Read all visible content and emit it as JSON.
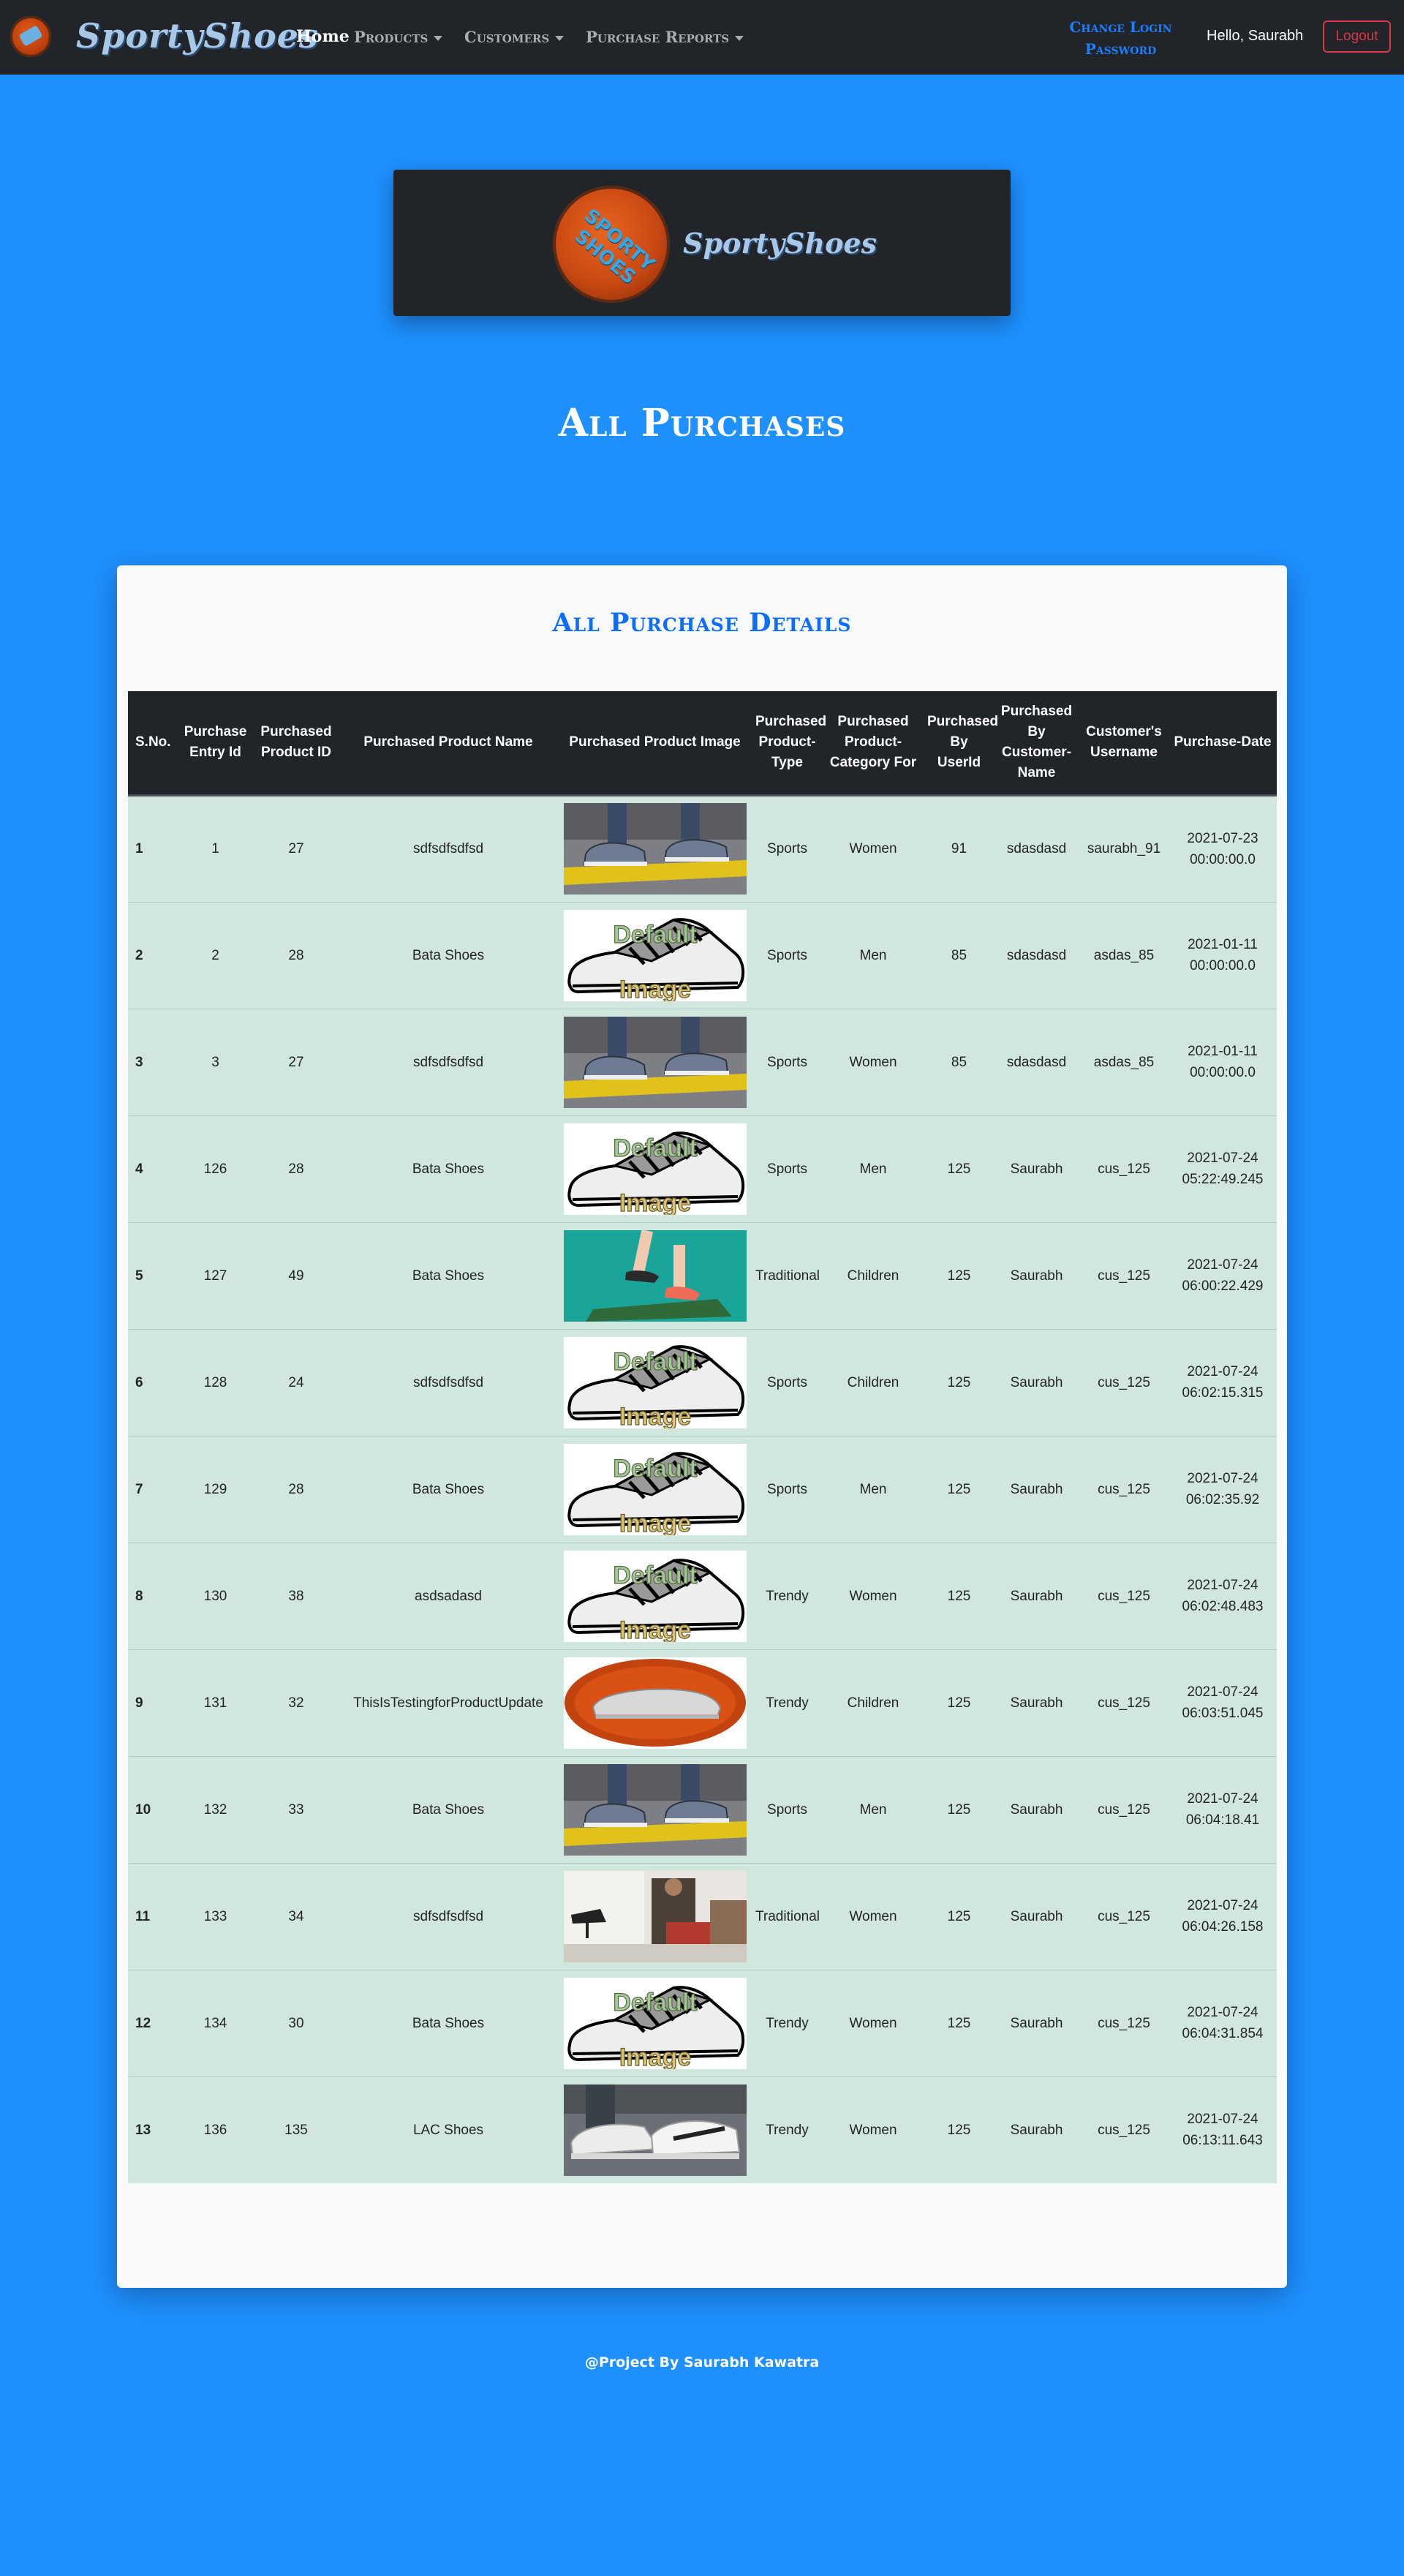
{
  "navbar": {
    "brand": "SportyShoes",
    "home": "Home",
    "products": "Products",
    "customers": "Customers",
    "purchase_reports": "Purchase Reports",
    "change_login_line1": "Change Login",
    "change_login_line2": "Password",
    "greeting": "Hello, Saurabh",
    "logout": "Logout"
  },
  "hero": {
    "circle_text": "SPORTY SHOES",
    "brand": "SportyShoes"
  },
  "page_title": "All Purchases",
  "card_title": "All Purchase Details",
  "table": {
    "headers": [
      "S.No.",
      "Purchase Entry Id",
      "Purchased Product ID",
      "Purchased Product Name",
      "Purchased Product Image",
      "Purchased Product-Type",
      "Purchased Product-Category For",
      "Purchased By UserId",
      "Purchased By Customer-Name",
      "Customer's Username",
      "Purchase-Date"
    ],
    "rows": [
      {
        "sno": "1",
        "entry": "1",
        "pid": "27",
        "name": "sdfsdfsdfsd",
        "image": "street-shoe-photo",
        "type": "Sports",
        "category": "Women",
        "userid": "91",
        "customer": "sdasdasd",
        "username": "saurabh_91",
        "date": "2021-07-23 00:00:00.0"
      },
      {
        "sno": "2",
        "entry": "2",
        "pid": "28",
        "name": "Bata Shoes",
        "image": "default-image",
        "type": "Sports",
        "category": "Men",
        "userid": "85",
        "customer": "sdasdasd",
        "username": "asdas_85",
        "date": "2021-01-11 00:00:00.0"
      },
      {
        "sno": "3",
        "entry": "3",
        "pid": "27",
        "name": "sdfsdfsdfsd",
        "image": "street-shoe-photo",
        "type": "Sports",
        "category": "Women",
        "userid": "85",
        "customer": "sdasdasd",
        "username": "asdas_85",
        "date": "2021-01-11 00:00:00.0"
      },
      {
        "sno": "4",
        "entry": "126",
        "pid": "28",
        "name": "Bata Shoes",
        "image": "default-image",
        "type": "Sports",
        "category": "Men",
        "userid": "125",
        "customer": "Saurabh",
        "username": "cus_125",
        "date": "2021-07-24 05:22:49.245"
      },
      {
        "sno": "5",
        "entry": "127",
        "pid": "49",
        "name": "Bata Shoes",
        "image": "teal-legs-photo",
        "type": "Traditional",
        "category": "Children",
        "userid": "125",
        "customer": "Saurabh",
        "username": "cus_125",
        "date": "2021-07-24 06:00:22.429"
      },
      {
        "sno": "6",
        "entry": "128",
        "pid": "24",
        "name": "sdfsdfsdfsd",
        "image": "default-image",
        "type": "Sports",
        "category": "Children",
        "userid": "125",
        "customer": "Saurabh",
        "username": "cus_125",
        "date": "2021-07-24 06:02:15.315"
      },
      {
        "sno": "7",
        "entry": "129",
        "pid": "28",
        "name": "Bata Shoes",
        "image": "default-image",
        "type": "Sports",
        "category": "Men",
        "userid": "125",
        "customer": "Saurabh",
        "username": "cus_125",
        "date": "2021-07-24 06:02:35.92"
      },
      {
        "sno": "8",
        "entry": "130",
        "pid": "38",
        "name": "asdsadasd",
        "image": "default-image",
        "type": "Trendy",
        "category": "Women",
        "userid": "125",
        "customer": "Saurabh",
        "username": "cus_125",
        "date": "2021-07-24 06:02:48.483"
      },
      {
        "sno": "9",
        "entry": "131",
        "pid": "32",
        "name": "ThisIsTestingforProductUpdate",
        "image": "orange-oval-shoe",
        "type": "Trendy",
        "category": "Children",
        "userid": "125",
        "customer": "Saurabh",
        "username": "cus_125",
        "date": "2021-07-24 06:03:51.045"
      },
      {
        "sno": "10",
        "entry": "132",
        "pid": "33",
        "name": "Bata Shoes",
        "image": "street-shoe-photo",
        "type": "Sports",
        "category": "Men",
        "userid": "125",
        "customer": "Saurabh",
        "username": "cus_125",
        "date": "2021-07-24 06:04:18.41"
      },
      {
        "sno": "11",
        "entry": "133",
        "pid": "34",
        "name": "sdfsdfsdfsd",
        "image": "shoe-store-photo",
        "type": "Traditional",
        "category": "Women",
        "userid": "125",
        "customer": "Saurabh",
        "username": "cus_125",
        "date": "2021-07-24 06:04:26.158"
      },
      {
        "sno": "12",
        "entry": "134",
        "pid": "30",
        "name": "Bata Shoes",
        "image": "default-image",
        "type": "Trendy",
        "category": "Women",
        "userid": "125",
        "customer": "Saurabh",
        "username": "cus_125",
        "date": "2021-07-24 06:04:31.854"
      },
      {
        "sno": "13",
        "entry": "136",
        "pid": "135",
        "name": "LAC Shoes",
        "image": "white-sneaker-photo",
        "type": "Trendy",
        "category": "Women",
        "userid": "125",
        "customer": "Saurabh",
        "username": "cus_125",
        "date": "2021-07-24 06:13:11.643"
      }
    ],
    "default_image_text": [
      "Default",
      "Image"
    ]
  },
  "footer": "@Project By Saurabh Kawatra",
  "colors": {
    "page_bg": "#1e90ff",
    "navbar_bg": "#212529",
    "row_bg": "#d1e7dd",
    "accent": "#0d6efd",
    "logout": "#dc3545"
  }
}
